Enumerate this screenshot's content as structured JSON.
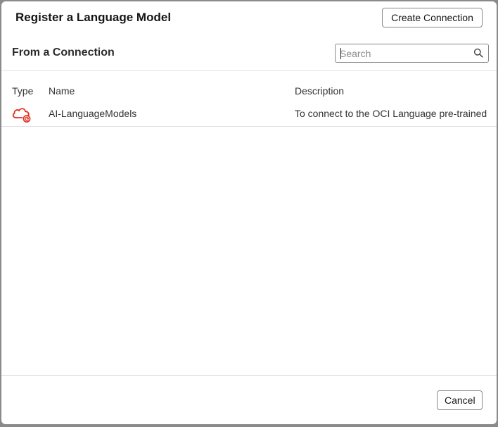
{
  "dialog": {
    "title": "Register a Language Model",
    "create_connection_label": "Create Connection",
    "cancel_label": "Cancel"
  },
  "section": {
    "subtitle": "From a Connection"
  },
  "search": {
    "placeholder": "Search",
    "value": "",
    "icon": "search-icon"
  },
  "table": {
    "columns": [
      "Type",
      "Name",
      "Description"
    ],
    "rows": [
      {
        "type_icon": "cloud-connection-icon",
        "name": "AI-LanguageModels",
        "description": "To connect to the OCI Language pre-trained"
      }
    ]
  },
  "colors": {
    "accent_red": "#e0301e",
    "border": "#8a8886",
    "divider": "#e2e2e2"
  }
}
